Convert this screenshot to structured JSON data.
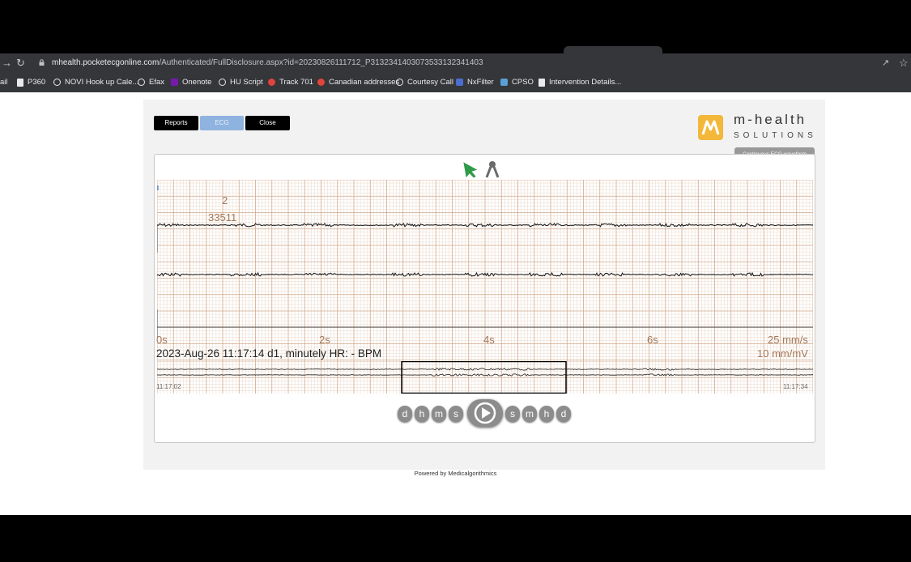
{
  "browser": {
    "url_host": "mhealth.pocketecgonline.com",
    "url_path": "/Authenticated/FullDisclosure.aspx?id=20230826111712_P3132341403073533132341403",
    "bookmarks": [
      {
        "label": "ail",
        "icon": "mail-icon",
        "color": "#9aa0a6"
      },
      {
        "label": "P360",
        "icon": "document-icon",
        "color": "#e8eaed"
      },
      {
        "label": "NOVI Hook up Cale...",
        "icon": "globe-icon",
        "color": "#e8eaed"
      },
      {
        "label": "Efax",
        "icon": "globe-icon",
        "color": "#e8eaed"
      },
      {
        "label": "Onenote",
        "icon": "onenote-icon",
        "color": "#7719aa"
      },
      {
        "label": "HU Script",
        "icon": "globe-icon",
        "color": "#e8eaed"
      },
      {
        "label": "Track 701",
        "icon": "redarrow-icon",
        "color": "#e0443b"
      },
      {
        "label": "Canadian addresses",
        "icon": "redarrow-icon",
        "color": "#e0443b"
      },
      {
        "label": "Courtesy Call",
        "icon": "globe-icon",
        "color": "#e8eaed"
      },
      {
        "label": "NxFilter",
        "icon": "nx-icon",
        "color": "#4a6fd1"
      },
      {
        "label": "CPSO",
        "icon": "cpso-icon",
        "color": "#5aa0d6"
      },
      {
        "label": "Intervention Details...",
        "icon": "document-icon",
        "color": "#e8eaed"
      }
    ]
  },
  "toolbar": {
    "reports": "Reports",
    "ecg": "ECG",
    "close": "Close"
  },
  "logo": {
    "main": "m-health",
    "sub": "SOLUTIONS"
  },
  "waveform_label": "Continuous ECG waveform",
  "ecg": {
    "channel_number": "2",
    "sample_value": "33511",
    "time_labels": [
      "0s",
      "2s",
      "4s",
      "6s"
    ],
    "speed": "25 mm/s",
    "gain": "10 mm/mV",
    "info": "2023-Aug-26 11:17:14 d1, minutely HR: - BPM",
    "overview_start": "11:17:02",
    "overview_end": "11:17:34"
  },
  "controls": {
    "back": [
      "d",
      "h",
      "m",
      "s"
    ],
    "forward": [
      "s",
      "m",
      "h",
      "d"
    ]
  },
  "footer": {
    "powered": "Powered by Medicalgorithmics"
  },
  "colors": {
    "grid_minor": "#ead7c9",
    "grid_major": "#d1a98b",
    "trace": "#111111",
    "ecg_button": "#8fb3df",
    "logo": "#f3b73a"
  }
}
